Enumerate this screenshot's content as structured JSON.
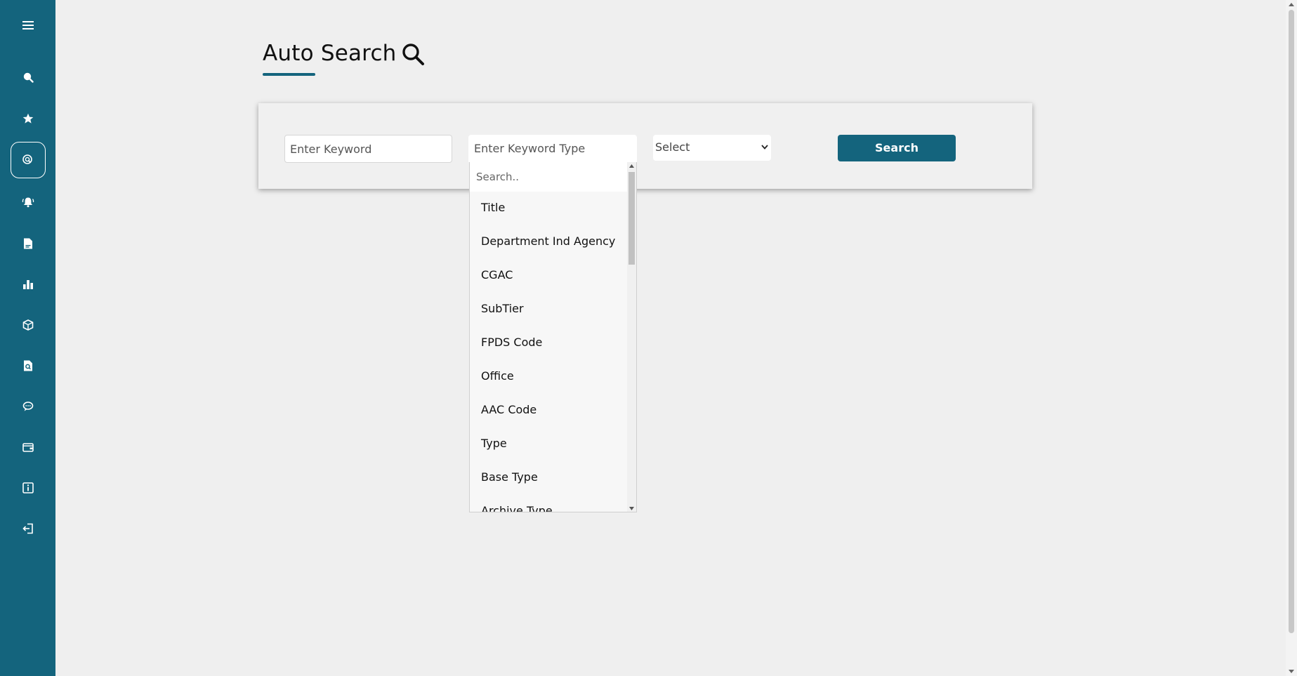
{
  "sidebar": {
    "bg_color": "#14647d",
    "items": [
      {
        "icon": "menu-icon"
      },
      {
        "icon": "search-icon"
      },
      {
        "icon": "star-icon"
      },
      {
        "icon": "auto-search-icon",
        "active": true
      },
      {
        "icon": "bell-icon"
      },
      {
        "icon": "document-icon"
      },
      {
        "icon": "bar-chart-icon"
      },
      {
        "icon": "box-icon"
      },
      {
        "icon": "file-search-icon"
      },
      {
        "icon": "chat-icon"
      },
      {
        "icon": "wallet-icon"
      },
      {
        "icon": "info-icon"
      },
      {
        "icon": "logout-icon"
      }
    ]
  },
  "header": {
    "title": "Auto Search",
    "title_icon": "search-icon"
  },
  "search_form": {
    "keyword_placeholder": "Enter Keyword",
    "keyword_type_placeholder": "Enter Keyword Type",
    "select_value": "Select",
    "search_button_label": "Search"
  },
  "keyword_type_dropdown": {
    "search_placeholder": "Search..",
    "options": [
      "Title",
      "Department Ind Agency",
      "CGAC",
      "SubTier",
      "FPDS Code",
      "Office",
      "AAC Code",
      "Type",
      "Base Type",
      "Archive Type"
    ]
  },
  "colors": {
    "accent": "#14647d",
    "background": "#efefef"
  }
}
